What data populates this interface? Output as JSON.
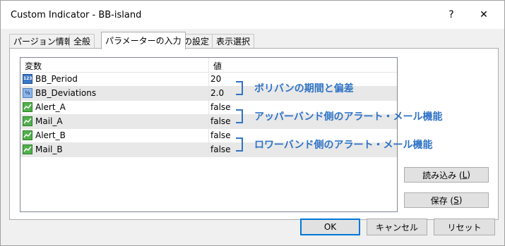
{
  "window": {
    "title": "Custom Indicator - BB-island",
    "help_glyph": "?",
    "close_glyph": "✕"
  },
  "tabs": [
    {
      "label": "パージョン情報",
      "active": false
    },
    {
      "label": "全般",
      "active": false
    },
    {
      "label": "パラメーターの入力",
      "active": true
    },
    {
      "label": "色の設定",
      "active": false
    },
    {
      "label": "表示選択",
      "active": false
    }
  ],
  "grid": {
    "header_variable": "変数",
    "header_value": "値",
    "rows": [
      {
        "icon": "integer-icon",
        "icon_text": "123",
        "name": "BB_Period",
        "value": "20"
      },
      {
        "icon": "double-icon",
        "icon_text": "½",
        "name": "BB_Deviations",
        "value": "2.0"
      },
      {
        "icon": "bool-icon",
        "icon_text": "",
        "name": "Alert_A",
        "value": "false"
      },
      {
        "icon": "bool-icon",
        "icon_text": "",
        "name": "Mail_A",
        "value": "false"
      },
      {
        "icon": "bool-icon",
        "icon_text": "",
        "name": "Alert_B",
        "value": "false"
      },
      {
        "icon": "bool-icon",
        "icon_text": "",
        "name": "Mail_B",
        "value": "false"
      }
    ]
  },
  "annotations": [
    "ボリバンの期間と偏差",
    "アッパーバンド側のアラート・メール機能",
    "ロワーバンド側のアラート・メール機能"
  ],
  "side_buttons": {
    "load_label": "読み込み (",
    "load_key": "L",
    "load_tail": ")",
    "save_label": "保存 (",
    "save_key": "S",
    "save_tail": ")"
  },
  "footer": {
    "ok": "OK",
    "cancel": "キャンセル",
    "reset": "リセット"
  },
  "colors": {
    "accent": "#2f73c6",
    "default_button_border": "#0078d7"
  }
}
